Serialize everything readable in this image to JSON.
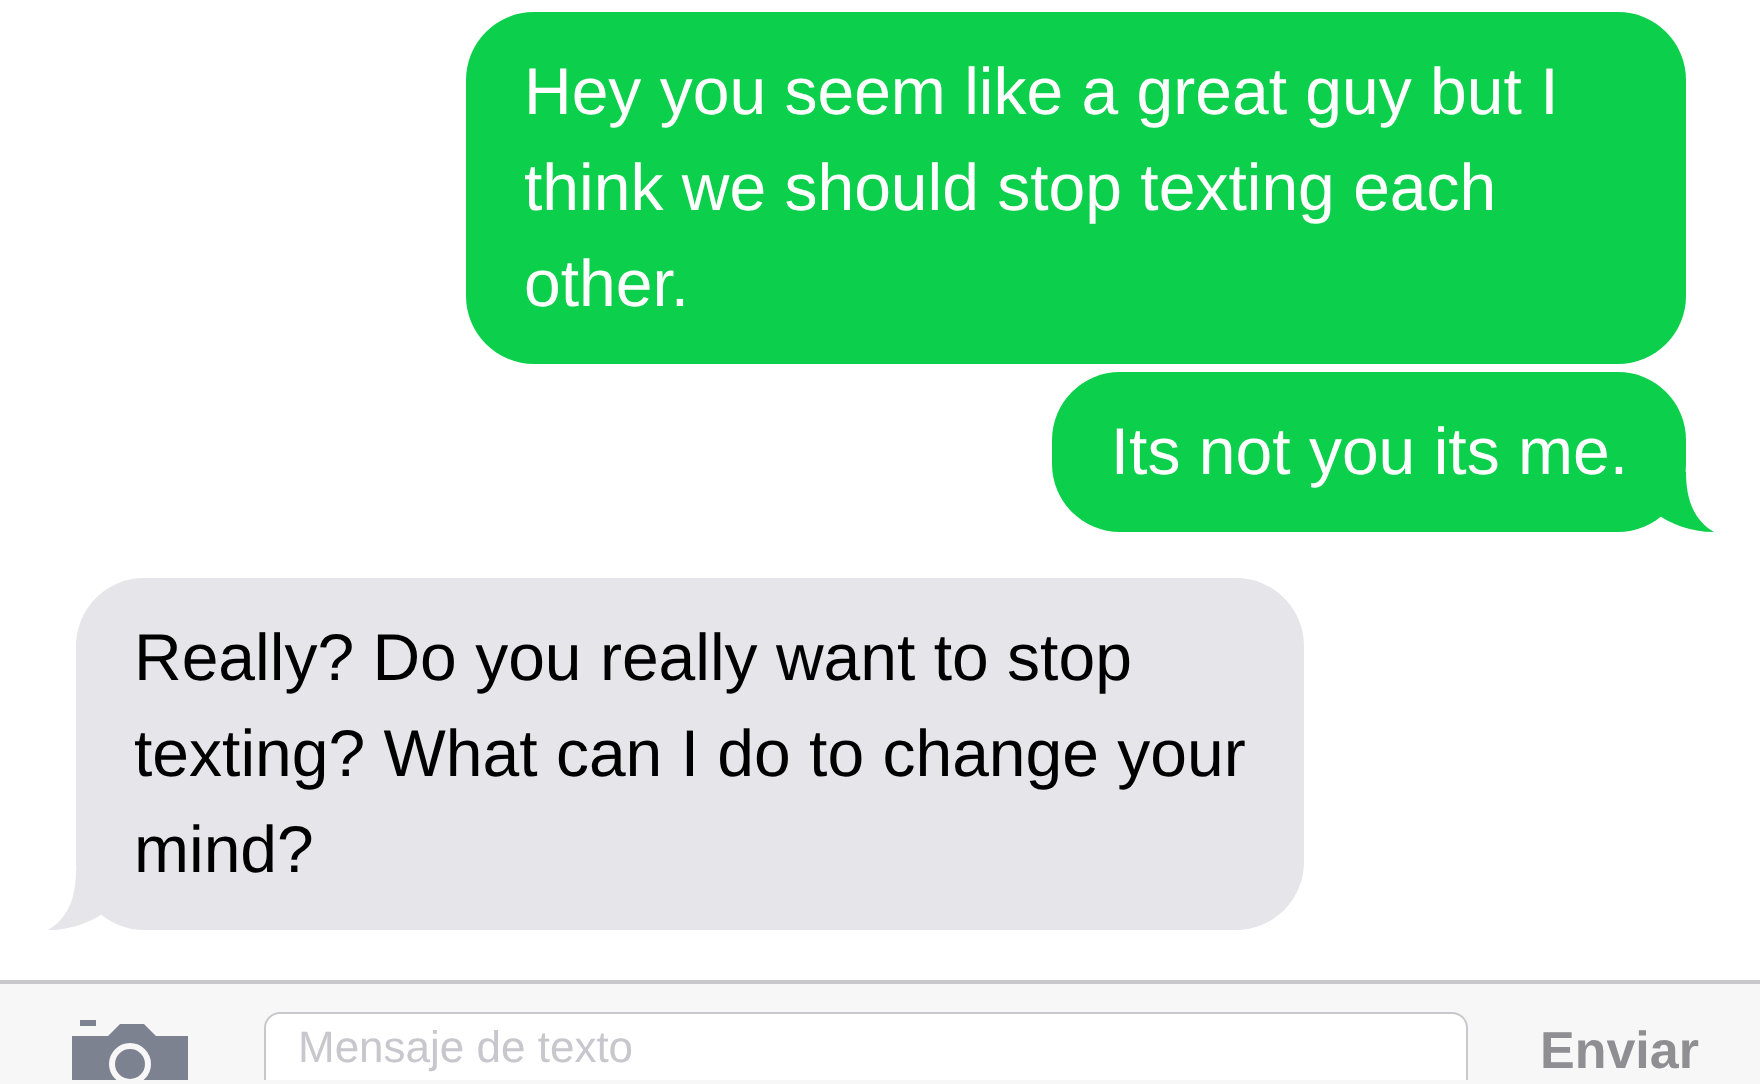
{
  "messages": [
    {
      "kind": "sent",
      "text": "Hey you seem like a great guy but I think we should stop texting each other.",
      "tail": false
    },
    {
      "kind": "sent",
      "text": "Its not you its me.",
      "tail": true
    },
    {
      "kind": "received",
      "text": "Really? Do you really want to stop texting? What can I do to change your mind?",
      "tail": true
    }
  ],
  "composer": {
    "placeholder": "Mensaje de texto",
    "send": "Enviar"
  }
}
